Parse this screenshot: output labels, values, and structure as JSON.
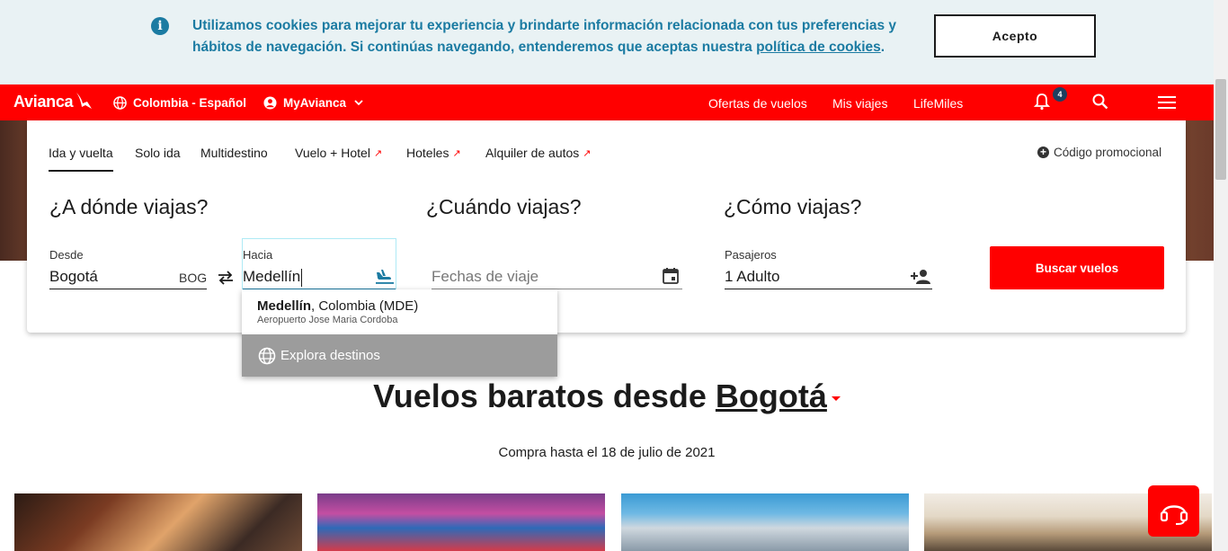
{
  "cookie_banner": {
    "message": "Utilizamos cookies para mejorar tu experiencia y brindarte información relacionada con tus preferencias y hábitos de navegación. Si continúas navegando, entenderemos que aceptas nuestra ",
    "link_text": "política de cookies",
    "message_end": ".",
    "accept_label": "Acepto"
  },
  "header": {
    "logo": "Avianca",
    "country_language": "Colombia - Español",
    "account": "MyAvianca",
    "nav": [
      "Ofertas de vuelos",
      "Mis viajes",
      "LifeMiles"
    ],
    "notifications_count": "4"
  },
  "booking": {
    "tabs": [
      "Ida y vuelta",
      "Solo ida",
      "Multidestino",
      "Vuelo + Hotel",
      "Hoteles",
      "Alquiler de autos"
    ],
    "promo_code": "Código promocional",
    "where_title": "¿A dónde viajas?",
    "when_title": "¿Cuándo viajas?",
    "how_title": "¿Cómo viajas?",
    "from_label": "Desde",
    "from_value": "Bogotá",
    "from_code": "BOG",
    "to_label": "Hacia",
    "to_value": "Medellín",
    "dates_placeholder": "Fechas de viaje",
    "passengers_label": "Pasajeros",
    "passengers_value": "1 Adulto",
    "search_button": "Buscar vuelos"
  },
  "dropdown": {
    "city": "Medellín",
    "country_code": ", Colombia (MDE)",
    "airport": "Aeropuerto Jose Maria Cordoba",
    "explore": "Explora destinos"
  },
  "deals": {
    "title_prefix": "Vuelos baratos desde ",
    "title_city": "Bogotá",
    "subtitle": "Compra hasta el 18 de julio de 2021"
  },
  "colors": {
    "brand_red": "#ff0000",
    "info_blue": "#1b7ba2"
  }
}
